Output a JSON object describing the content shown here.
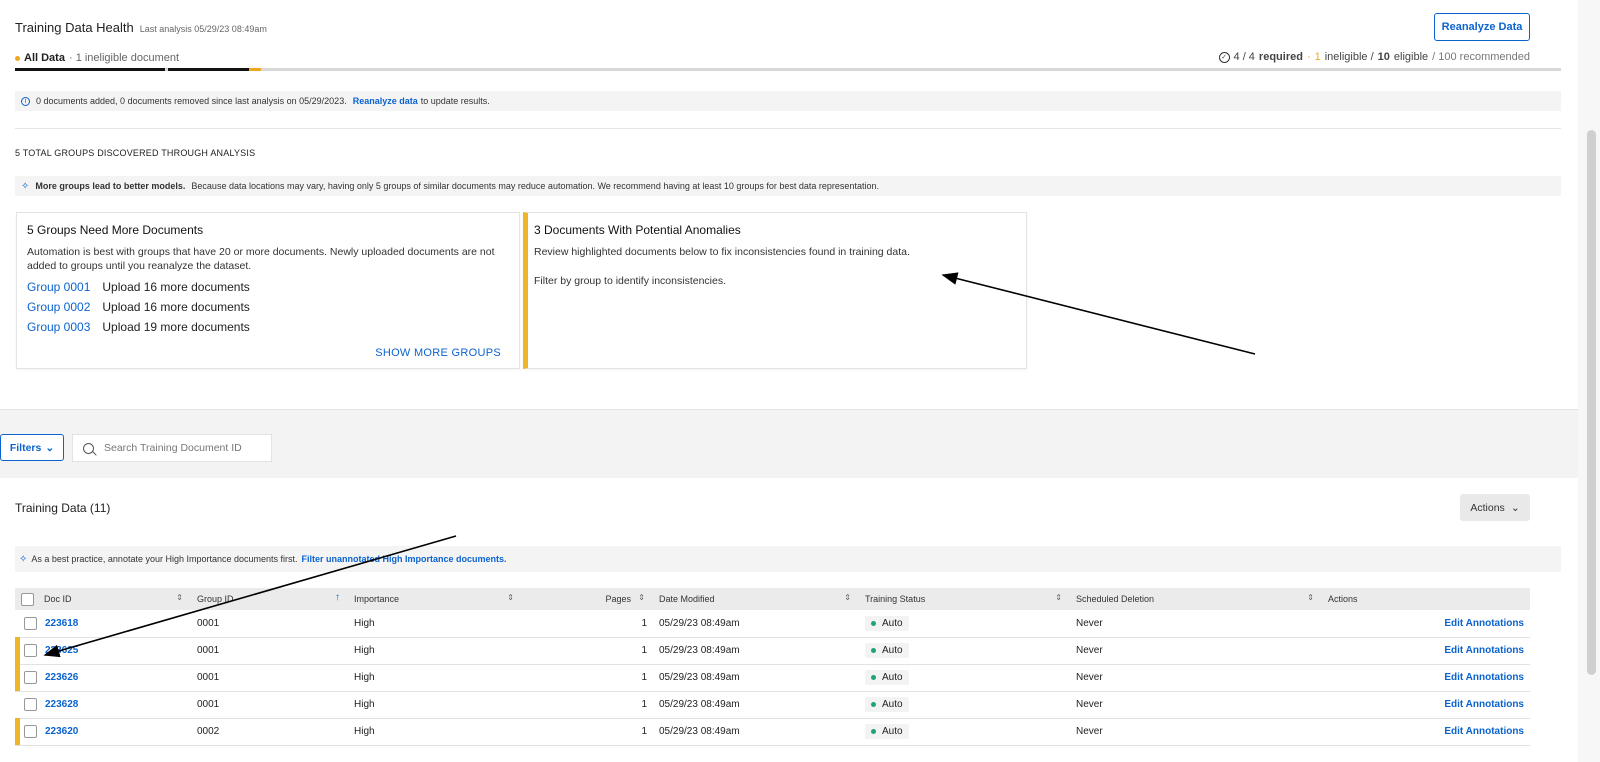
{
  "health": {
    "title": "Training Data Health",
    "last_analysis": "Last analysis 05/29/23 08:49am",
    "reanalyze_label": "Reanalyze Data",
    "all_data_label": "All Data",
    "ineligible_note": "· 1 ineligible document",
    "required_count": "4 / 4",
    "required_label": "required",
    "separator": "·",
    "ineligible_count": "1",
    "ineligible_label": "ineligible /",
    "eligible_count": "10",
    "eligible_label": "eligible",
    "recommended": "/ 100 recommended",
    "info_text": "0 documents added, 0 documents removed since last analysis on 05/29/2023.",
    "info_link": "Reanalyze data",
    "info_suffix": "to update results."
  },
  "groups": {
    "heading": "5 TOTAL GROUPS DISCOVERED THROUGH ANALYSIS",
    "tip_bold": "More groups lead to better models.",
    "tip_text": "Because data locations may vary, having only 5 groups of similar documents may reduce automation. We recommend having at least 10 groups for best data representation."
  },
  "card_groups": {
    "title": "5 Groups Need More Documents",
    "desc": "Automation is best with groups that have 20 or more documents. Newly uploaded documents are not added to groups until you reanalyze the dataset.",
    "rows": [
      {
        "group": "Group 0001",
        "action": "Upload 16 more documents"
      },
      {
        "group": "Group 0002",
        "action": "Upload 16 more documents"
      },
      {
        "group": "Group 0003",
        "action": "Upload 19 more documents"
      }
    ],
    "show_more": "SHOW MORE GROUPS"
  },
  "card_anomalies": {
    "title": "3 Documents With Potential Anomalies",
    "line1": "Review highlighted documents below to fix inconsistencies found in training data.",
    "line2": "Filter by group to identify inconsistencies."
  },
  "toolbar": {
    "filters_label": "Filters",
    "search_placeholder": "Search Training Document ID"
  },
  "training": {
    "title": "Training Data (11)",
    "actions_label": "Actions",
    "practice_text": "As a best practice, annotate your High Importance documents first.",
    "practice_link": "Filter unannotated High Importance documents."
  },
  "table": {
    "columns": [
      "Doc ID",
      "Group ID",
      "Importance",
      "Pages",
      "Date Modified",
      "Training Status",
      "Scheduled Deletion",
      "Actions"
    ],
    "rows": [
      {
        "doc": "223618",
        "group": "0001",
        "importance": "High",
        "pages": "1",
        "date": "05/29/23 08:49am",
        "status": "Auto",
        "deletion": "Never",
        "action": "Edit Annotations",
        "flagged": false
      },
      {
        "doc": "223625",
        "group": "0001",
        "importance": "High",
        "pages": "1",
        "date": "05/29/23 08:49am",
        "status": "Auto",
        "deletion": "Never",
        "action": "Edit Annotations",
        "flagged": true
      },
      {
        "doc": "223626",
        "group": "0001",
        "importance": "High",
        "pages": "1",
        "date": "05/29/23 08:49am",
        "status": "Auto",
        "deletion": "Never",
        "action": "Edit Annotations",
        "flagged": true
      },
      {
        "doc": "223628",
        "group": "0001",
        "importance": "High",
        "pages": "1",
        "date": "05/29/23 08:49am",
        "status": "Auto",
        "deletion": "Never",
        "action": "Edit Annotations",
        "flagged": false
      },
      {
        "doc": "223620",
        "group": "0002",
        "importance": "High",
        "pages": "1",
        "date": "05/29/23 08:49am",
        "status": "Auto",
        "deletion": "Never",
        "action": "Edit Annotations",
        "flagged": true
      }
    ]
  },
  "colors": {
    "accent": "#0b63ce",
    "warning": "#f0b429",
    "success": "#1ea37a"
  }
}
